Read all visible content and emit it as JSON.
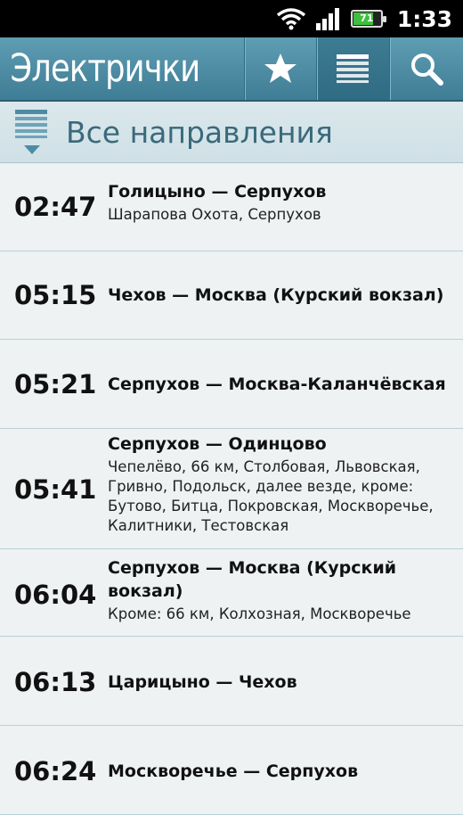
{
  "status": {
    "battery": "71",
    "time": "1:33"
  },
  "app": {
    "title": "Электрички"
  },
  "direction": {
    "label": "Все направления"
  },
  "trains": [
    {
      "time": "02:47",
      "route": "Голицыно — Серпухов",
      "stops": "Шарапова Охота, Серпухов"
    },
    {
      "time": "05:15",
      "route": "Чехов — Москва (Курский вокзал)",
      "stops": ""
    },
    {
      "time": "05:21",
      "route": "Серпухов — Москва-Каланчёвская",
      "stops": ""
    },
    {
      "time": "05:41",
      "route": "Серпухов — Одинцово",
      "stops": "Чепелёво, 66 км, Столбовая, Львовская, Гривно, Подольск, далее везде, кроме: Бутово, Битца, Покровская, Москворечье, Калитники, Тестовская"
    },
    {
      "time": "06:04",
      "route": "Серпухов — Москва (Курский вокзал)",
      "stops": "Кроме: 66 км, Колхозная, Москворечье"
    },
    {
      "time": "06:13",
      "route": "Царицыно — Чехов",
      "stops": ""
    },
    {
      "time": "06:24",
      "route": "Москворечье — Серпухов",
      "stops": ""
    }
  ]
}
